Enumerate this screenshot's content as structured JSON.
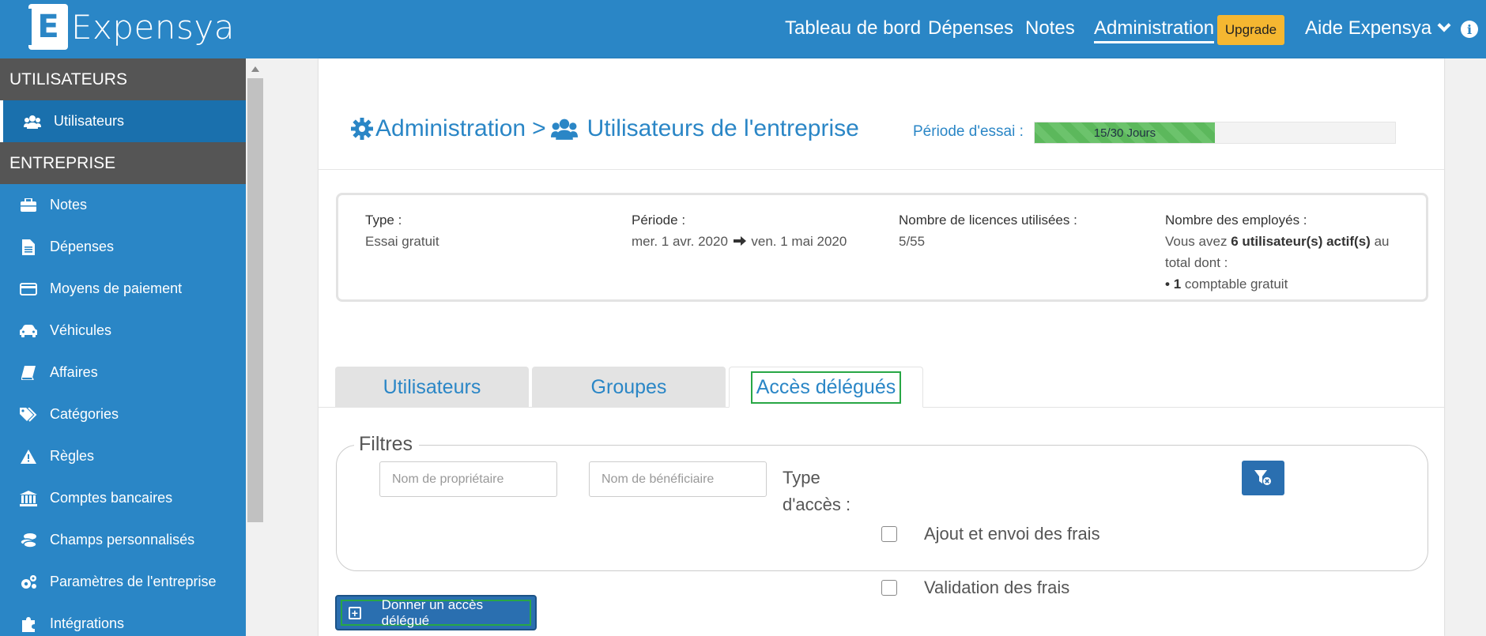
{
  "brand": {
    "logo_letter": "E",
    "name": "Expensya"
  },
  "nav": {
    "dashboard": "Tableau de bord",
    "expenses": "Dépenses",
    "notes": "Notes",
    "admin": "Administration",
    "upgrade": "Upgrade",
    "help": "Aide Expensya",
    "info_icon": "i"
  },
  "colors": {
    "primary": "#2a86c6",
    "upgrade": "#f5b731",
    "progress": "#5cb85c",
    "highlight": "#28a745",
    "sidebar_header": "#555555"
  },
  "sidebar": {
    "section_users": "UTILISATEURS",
    "users": "Utilisateurs",
    "section_company": "ENTREPRISE",
    "items": [
      {
        "label": "Notes",
        "icon": "briefcase-icon"
      },
      {
        "label": "Dépenses",
        "icon": "file-icon"
      },
      {
        "label": "Moyens de paiement",
        "icon": "credit-card-icon"
      },
      {
        "label": "Véhicules",
        "icon": "car-icon"
      },
      {
        "label": "Affaires",
        "icon": "book-icon"
      },
      {
        "label": "Catégories",
        "icon": "tags-icon"
      },
      {
        "label": "Règles",
        "icon": "warning-icon"
      },
      {
        "label": "Comptes bancaires",
        "icon": "bank-icon"
      },
      {
        "label": "Champs personnalisés",
        "icon": "coins-icon"
      },
      {
        "label": "Paramètres de l'entreprise",
        "icon": "cogs-icon"
      },
      {
        "label": "Intégrations",
        "icon": "puzzle-icon"
      }
    ]
  },
  "header": {
    "title_admin": "Administration",
    "separator": ">",
    "title_users": "Utilisateurs de l'entreprise",
    "trial_label": "Période d'essai :",
    "trial_progress": "15/30 Jours",
    "trial_fraction": 0.5
  },
  "info": {
    "type_label": "Type :",
    "type_value": "Essai gratuit",
    "period_label": "Période :",
    "period_start": "mer. 1 avr. 2020",
    "period_end": "ven. 1 mai 2020",
    "licenses_label": "Nombre de licences utilisées :",
    "licenses_value": "5/55",
    "employees_label": "Nombre des employés :",
    "employees_pre": "Vous avez",
    "employees_bold": "6 utilisateur(s) actif(s)",
    "employees_post": "au total dont :",
    "accountant_bullet": "•",
    "accountant_num": "1",
    "accountant_text": "comptable gratuit"
  },
  "tabs": [
    {
      "label": "Utilisateurs"
    },
    {
      "label": "Groupes"
    },
    {
      "label": "Accès délégués"
    }
  ],
  "filters": {
    "legend": "Filtres",
    "owner_placeholder": "Nom de propriétaire",
    "beneficiary_placeholder": "Nom de bénéficiaire",
    "access_type_label": "Type d'accès :",
    "opt_add_send": "Ajout et envoi des frais",
    "opt_validation": "Validation des frais"
  },
  "actions": {
    "delegate_button": "Donner un accès délégué"
  }
}
